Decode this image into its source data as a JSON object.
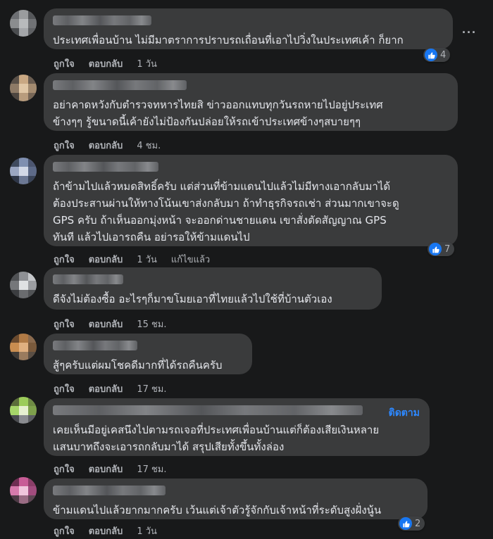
{
  "actions": {
    "like": "ถูกใจ",
    "reply": "ตอบกลับ",
    "edited": "แก้ไขแล้ว"
  },
  "follow_label": "ติดตาม",
  "comments": [
    {
      "text": "ประเทศเพื่อนบ้าน ไม่มีมาตราการปราบรถเถื่อนที่เอาไปวิ่งในประเทศเค้า ก็ยาก",
      "time": "1 วัน",
      "reactions": "4"
    },
    {
      "text": "อย่าคาดหวังกับตำรวจทหารไทยสิ ข่าวออกแทบทุกวันรถหายไปอยู่ประเทศ\nข้างๆๆ รู้ขนาดนี้เค้ายังไม่ป้องกันปล่อยให้รถเข้าประเทศข้างๆสบายๆๆ",
      "time": "4 ชม."
    },
    {
      "text": "ถ้าข้ามไปแล้วหมดสิทธิ์ครับ แต่ส่วนที่ข้ามแดนไปแล้วไม่มีทางเอากลับมาได้\nต้องประสานผ่านให้ทางโน้นเขาส่งกลับมา ถ้าทำธุรกิจรถเช่า ส่วนมากเขาจะดู\nGPS ครับ ถ้าเห็นออกมุ่งหน้า จะออกด่านชายแดน เขาสั่งตัดสัญญาณ GPS\nทันที แล้วไปเอารถคืน อย่ารอให้ข้ามแดนไป",
      "time": "1 วัน",
      "edited": true,
      "reactions": "7"
    },
    {
      "text": "ดีจังไม่ต้องซื้อ อะไรๆก็มาขโมยเอาที่ไทยแล้วไปใช้ที่บ้านตัวเอง",
      "time": "15 ชม."
    },
    {
      "text": "สู้ๆครับแต่ผมโชคดีมากที่ได้รถคืนครับ",
      "time": "17 ชม."
    },
    {
      "text": "เคยเห็นมีอยู่เคสนึงไปตามรถเจอที่ประเทศเพื่อนบ้านแต่ก็ต้องเสียเงินหลาย\nแสนบาทถึงจะเอารถกลับมาได้ สรุปเสียทั้งขึ้นทั้งล่อง",
      "time": "17 ชม.",
      "follow": true
    },
    {
      "text": "ข้ามแดนไปแล้วยากมากครับ เว้นแต่เจ้าตัวรู้จักกับเจ้าหน้าที่ระดับสูงฝั่งนู้น",
      "time": "1 วัน",
      "reactions": "2"
    }
  ]
}
